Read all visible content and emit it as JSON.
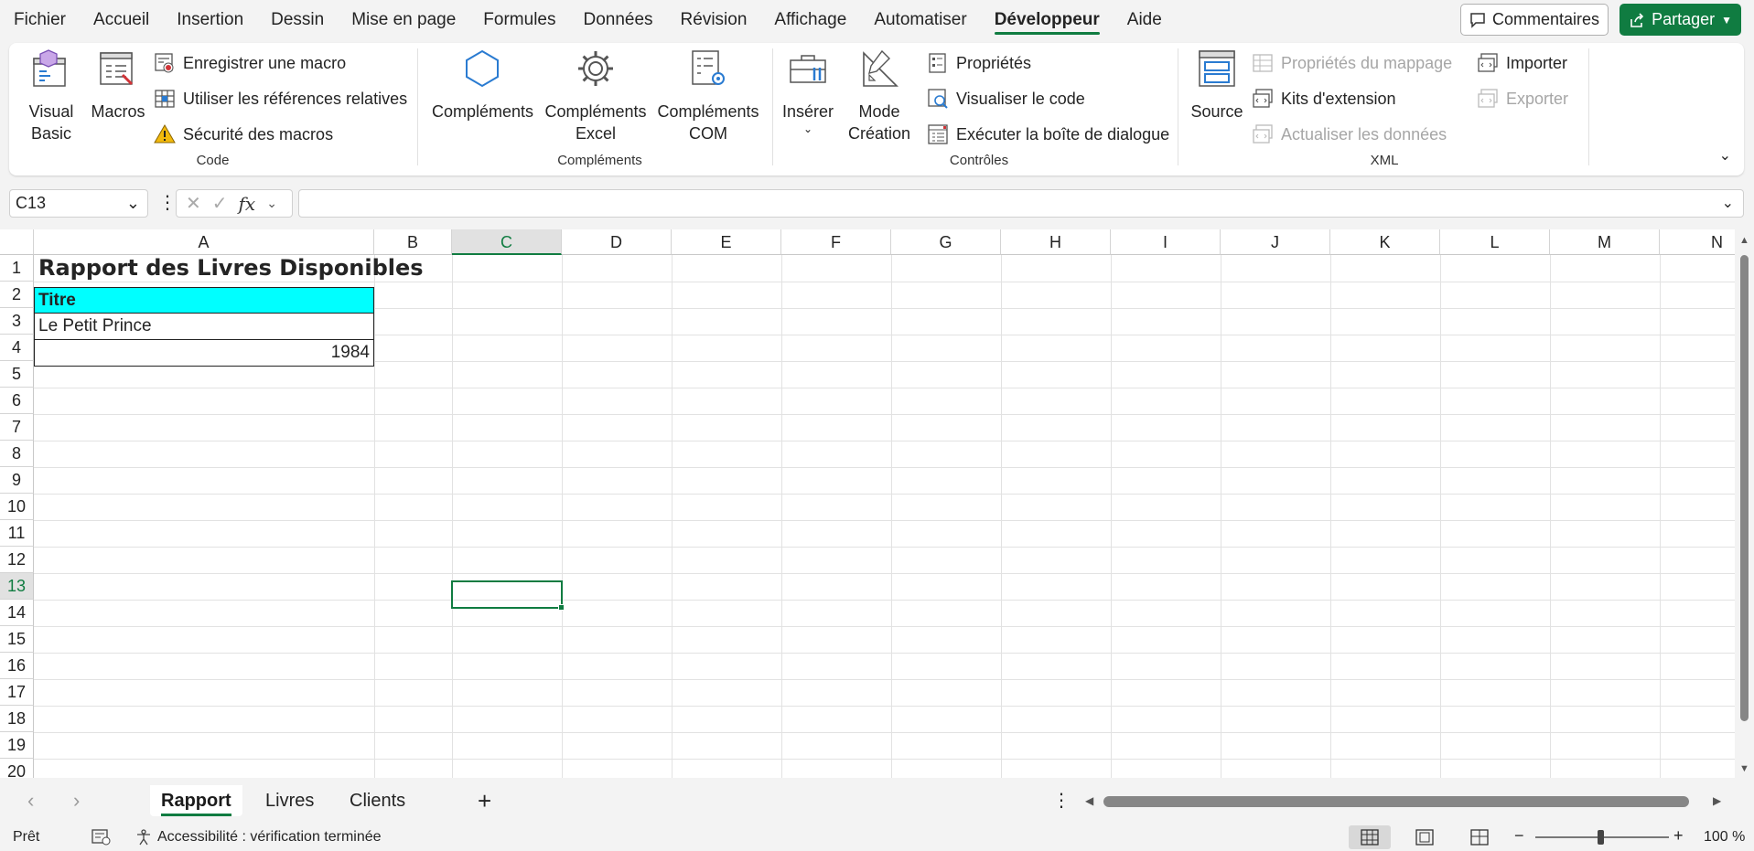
{
  "menu": {
    "tabs": [
      "Fichier",
      "Accueil",
      "Insertion",
      "Dessin",
      "Mise en page",
      "Formules",
      "Données",
      "Révision",
      "Affichage",
      "Automatiser",
      "Développeur",
      "Aide"
    ],
    "active_tab": "Développeur",
    "comments_label": "Commentaires",
    "share_label": "Partager"
  },
  "ribbon": {
    "code": {
      "label": "Code",
      "visual_basic": "Visual Basic",
      "macros": "Macros",
      "record_macro": "Enregistrer une macro",
      "relative_refs": "Utiliser les références relatives",
      "macro_security": "Sécurité des macros"
    },
    "addins": {
      "label": "Compléments",
      "addins": "Compléments",
      "excel_addins_1": "Compléments",
      "excel_addins_2": "Excel",
      "com_addins_1": "Compléments",
      "com_addins_2": "COM"
    },
    "controls": {
      "label": "Contrôles",
      "insert": "Insérer",
      "design_mode_1": "Mode",
      "design_mode_2": "Création",
      "properties": "Propriétés",
      "view_code": "Visualiser le code",
      "run_dialog": "Exécuter la boîte de dialogue"
    },
    "xml": {
      "label": "XML",
      "source": "Source",
      "map_properties": "Propriétés du mappage",
      "expansion_packs": "Kits d'extension",
      "refresh_data": "Actualiser les données",
      "import": "Importer",
      "export": "Exporter"
    }
  },
  "formula_bar": {
    "name_box": "C13",
    "formula": ""
  },
  "sheet": {
    "columns": [
      "A",
      "B",
      "C",
      "D",
      "E",
      "F",
      "G",
      "H",
      "I",
      "J",
      "K",
      "L",
      "M",
      "N"
    ],
    "rows": [
      "1",
      "2",
      "3",
      "4",
      "5",
      "6",
      "7",
      "8",
      "9",
      "10",
      "11",
      "12",
      "13",
      "14",
      "15",
      "16",
      "17",
      "18",
      "19",
      "20"
    ],
    "cells": {
      "A1": "Rapport des Livres Disponibles",
      "A2": "Titre",
      "A3": "Le Petit Prince",
      "A4": "1984"
    },
    "selected_cell": "C13",
    "header_fill": "#00ffff"
  },
  "sheet_tabs": {
    "tabs": [
      "Rapport",
      "Livres",
      "Clients"
    ],
    "active": "Rapport"
  },
  "status": {
    "ready": "Prêt",
    "accessibility": "Accessibilité : vérification terminée",
    "zoom": "100 %"
  },
  "colors": {
    "accent": "#107c41"
  }
}
